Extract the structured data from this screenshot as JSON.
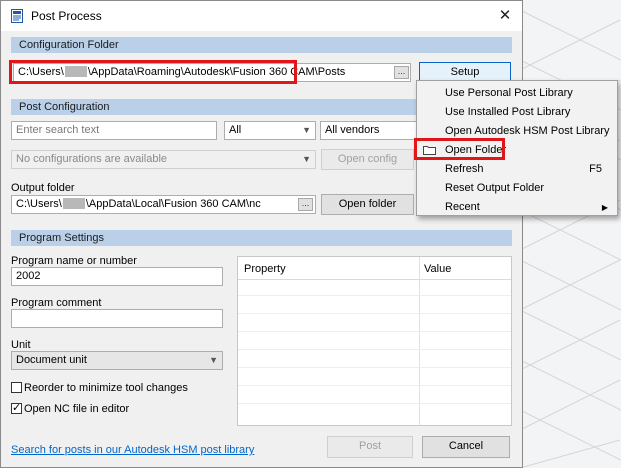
{
  "window": {
    "title": "Post Process",
    "close_glyph": "✕"
  },
  "config_folder": {
    "section_label": "Configuration Folder",
    "path_prefix": "C:\\Users\\",
    "path_suffix": "\\AppData\\Roaming\\Autodesk\\Fusion 360 CAM\\Posts",
    "browse_label": "...",
    "setup_button": "Setup"
  },
  "post_config": {
    "section_label": "Post Configuration",
    "search_placeholder": "Enter search text",
    "filter_select": "All",
    "vendor_select": "All vendors",
    "config_select": "No configurations are available",
    "open_config_button": "Open config",
    "output_folder_label": "Output folder",
    "output_path_prefix": "C:\\Users\\",
    "output_path_suffix": "\\AppData\\Local\\Fusion 360 CAM\\nc",
    "browse_label": "...",
    "open_folder_button": "Open folder"
  },
  "program_settings": {
    "section_label": "Program Settings",
    "program_name_label": "Program name or number",
    "program_name_value": "2002",
    "program_comment_label": "Program comment",
    "program_comment_value": "",
    "unit_label": "Unit",
    "unit_value": "Document unit",
    "reorder_label": "Reorder to minimize tool changes",
    "reorder_checked": false,
    "open_nc_label": "Open NC file in editor",
    "open_nc_checked": true,
    "property_columns": [
      "Property",
      "Value"
    ]
  },
  "footer": {
    "library_link": "Search for posts in our Autodesk HSM post library",
    "post_button": "Post",
    "cancel_button": "Cancel"
  },
  "setup_menu": {
    "items": [
      {
        "label": "Use Personal Post Library",
        "shortcut": ""
      },
      {
        "label": "Use Installed Post Library",
        "shortcut": ""
      },
      {
        "label": "Open Autodesk HSM Post Library",
        "shortcut": ""
      },
      {
        "label": "Open Folder",
        "shortcut": "",
        "icon": "folder-icon",
        "highlighted": true
      },
      {
        "label": "Refresh",
        "shortcut": "F5"
      },
      {
        "label": "Reset Output Folder",
        "shortcut": ""
      },
      {
        "label": "Recent",
        "shortcut": "",
        "submenu": true
      }
    ]
  },
  "colors": {
    "highlight_red": "#e0161b",
    "section_blue": "#b9d0e8",
    "link_blue": "#0066cc"
  }
}
